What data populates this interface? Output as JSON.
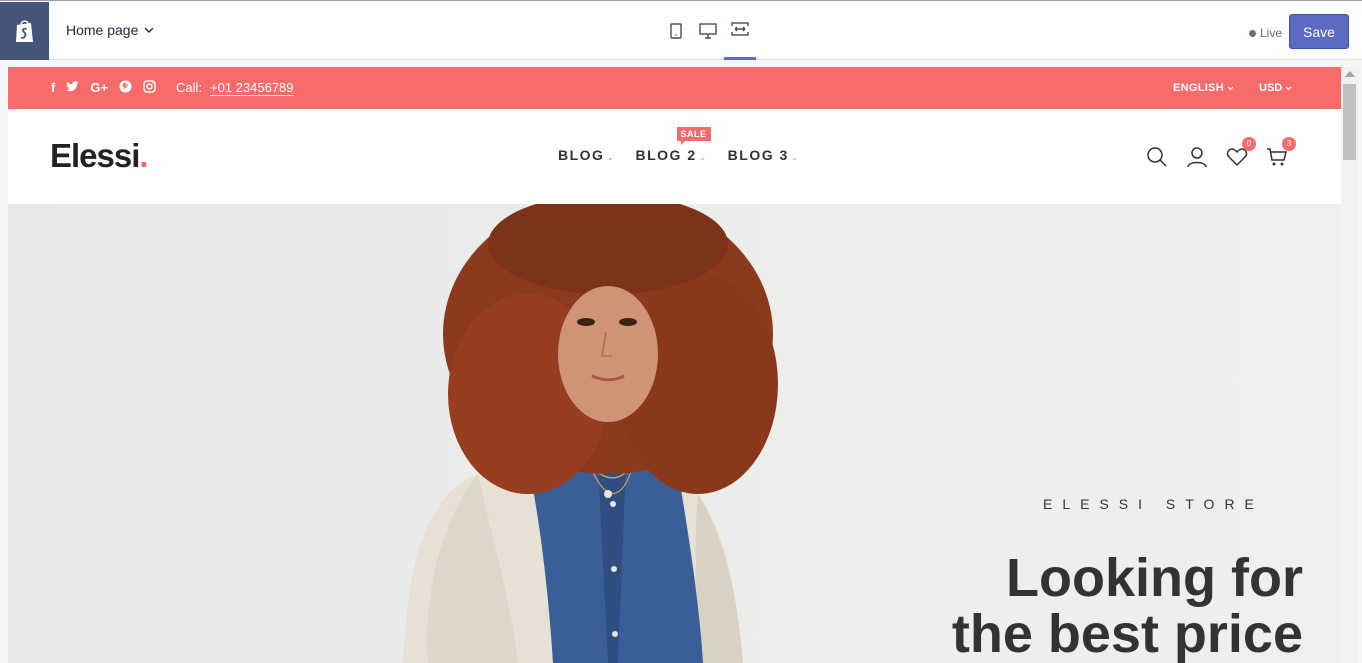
{
  "editor": {
    "page_selector": "Home page",
    "live_label": "Live",
    "save_label": "Save"
  },
  "topbar": {
    "call_label": "Call:",
    "phone": "+01 23456789",
    "language": "ENGLISH",
    "currency": "USD"
  },
  "header": {
    "brand": "Elessi",
    "brand_dot": ".",
    "nav": [
      {
        "label": "BLOG"
      },
      {
        "label": "BLOG 2",
        "badge": "SALE"
      },
      {
        "label": "BLOG 3"
      }
    ],
    "wishlist_count": "0",
    "cart_count": "3"
  },
  "hero": {
    "eyebrow": "ELESSI STORE",
    "title": "Looking for the best price"
  },
  "colors": {
    "accent": "#f76b6a",
    "save_button": "#5c6ac4",
    "editor_logo_bg": "#46567a"
  }
}
